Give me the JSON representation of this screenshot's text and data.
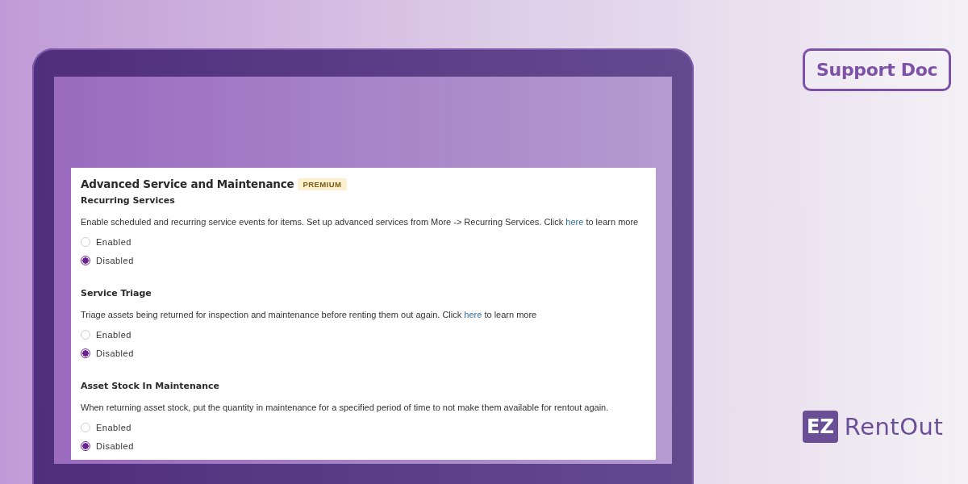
{
  "settings": {
    "title": "Advanced Service and Maintenance",
    "tag": "PREMIUM",
    "sections": [
      {
        "title": "Recurring Services",
        "description": {
          "before": "Enable scheduled and recurring service events for items. Set up advanced services from More -> Recurring Services. Click",
          "link": "here",
          "after": "to learn more"
        },
        "options": [
          {
            "label": "Enabled",
            "selected": false
          },
          {
            "label": "Disabled",
            "selected": true
          }
        ]
      },
      {
        "title": "Service Triage",
        "description": {
          "before": "Triage assets being returned for inspection and maintenance before renting them out again. Click",
          "link": "here",
          "after": "to learn more"
        },
        "options": [
          {
            "label": "Enabled",
            "selected": false
          },
          {
            "label": "Disabled",
            "selected": true
          }
        ]
      },
      {
        "title": "Asset Stock In Maintenance",
        "description": {
          "before": "When returning asset stock, put the quantity in maintenance for a specified period of time to not make them available for rentout again."
        },
        "options": [
          {
            "label": "Enabled",
            "selected": false
          },
          {
            "label": "Disabled",
            "selected": true
          }
        ]
      }
    ]
  },
  "badge": "Support Doc",
  "logo": {
    "mark": "EZ",
    "name": "RentOut"
  }
}
